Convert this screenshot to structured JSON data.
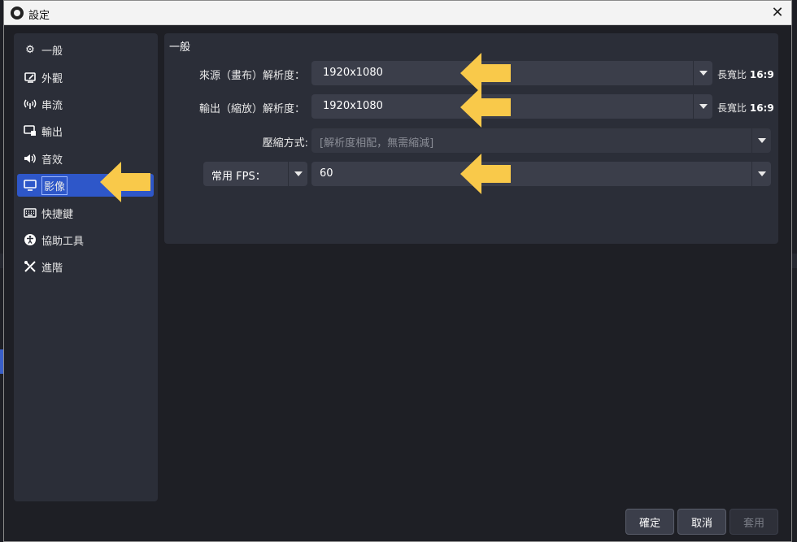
{
  "window": {
    "title": "設定",
    "close_label": "✕"
  },
  "sidebar": {
    "items": [
      {
        "label": "一般",
        "icon": "gear-icon"
      },
      {
        "label": "外觀",
        "icon": "appearance-icon"
      },
      {
        "label": "串流",
        "icon": "broadcast-icon"
      },
      {
        "label": "輸出",
        "icon": "output-icon"
      },
      {
        "label": "音效",
        "icon": "speaker-icon"
      },
      {
        "label": "影像",
        "icon": "monitor-icon"
      },
      {
        "label": "快捷鍵",
        "icon": "keyboard-icon"
      },
      {
        "label": "協助工具",
        "icon": "accessibility-icon"
      },
      {
        "label": "進階",
        "icon": "tools-icon"
      }
    ],
    "active_item": "影像"
  },
  "main": {
    "section_title": "一般",
    "base_resolution": {
      "label": "來源（畫布）解析度：",
      "value": "1920x1080",
      "aspect_label": "長寬比",
      "aspect_value": "16:9"
    },
    "output_resolution": {
      "label": "輸出（縮放）解析度：",
      "value": "1920x1080",
      "aspect_label": "長寬比",
      "aspect_value": "16:9"
    },
    "downscale": {
      "label": "壓縮方式:",
      "value": "[解析度相配，無需縮減]"
    },
    "fps": {
      "type_label": "常用 FPS：",
      "value": "60"
    }
  },
  "buttons": {
    "ok": "確定",
    "cancel": "取消",
    "apply": "套用"
  },
  "colors": {
    "accent": "#2e57c9",
    "arrow": "#f9c94a",
    "panel": "#2b2e38",
    "background": "#1e1f25"
  }
}
